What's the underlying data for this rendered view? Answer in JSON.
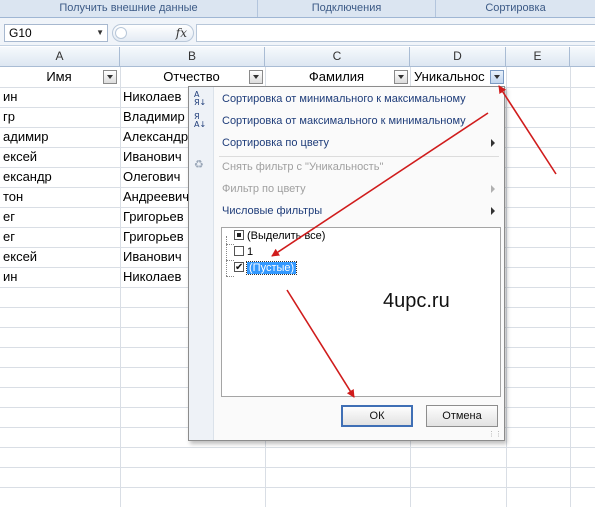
{
  "ribbon": {
    "groups": [
      "Получить внешние данные",
      "Подключения",
      "Сортировка"
    ]
  },
  "formula_bar": {
    "name_box": "G10",
    "fx_label": "fx",
    "formula_value": ""
  },
  "columns": [
    "A",
    "B",
    "C",
    "D",
    "E"
  ],
  "table": {
    "headers": [
      "Имя",
      "Отчество",
      "Фамилия",
      "Уникальнос"
    ],
    "rows": [
      [
        "ин",
        "Николаев"
      ],
      [
        "гр",
        "Владимир"
      ],
      [
        "адимир",
        "Александр"
      ],
      [
        "ексей",
        "Иванович"
      ],
      [
        "ександр",
        "Олегович"
      ],
      [
        "тон",
        "Андреевич"
      ],
      [
        "ег",
        "Григорьев"
      ],
      [
        "ег",
        "Григорьев"
      ],
      [
        "ексей",
        "Иванович"
      ],
      [
        "ин",
        "Николаев"
      ]
    ]
  },
  "filter_menu": {
    "items": [
      {
        "label": "Сортировка от минимального к максимальному",
        "enabled": true,
        "submenu": false
      },
      {
        "label": "Сортировка от максимального к минимальному",
        "enabled": true,
        "submenu": false
      },
      {
        "label": "Сортировка по цвету",
        "enabled": true,
        "submenu": true
      },
      {
        "label": "Снять фильтр с \"Уникальность\"",
        "enabled": false,
        "submenu": false
      },
      {
        "label": "Фильтр по цвету",
        "enabled": false,
        "submenu": true
      },
      {
        "label": "Числовые фильтры",
        "enabled": true,
        "submenu": true
      }
    ],
    "values": [
      {
        "label": "(Выделить все)",
        "state": "partial"
      },
      {
        "label": "1",
        "state": "unchecked"
      },
      {
        "label": "(Пустые)",
        "state": "checked"
      }
    ],
    "ok_label": "ОК",
    "cancel_label": "Отмена"
  },
  "watermark": "4upc.ru",
  "colors": {
    "annotation_arrow": "#d01c1c",
    "selection": "#3399ff",
    "menu_text": "#1f3d7a"
  }
}
